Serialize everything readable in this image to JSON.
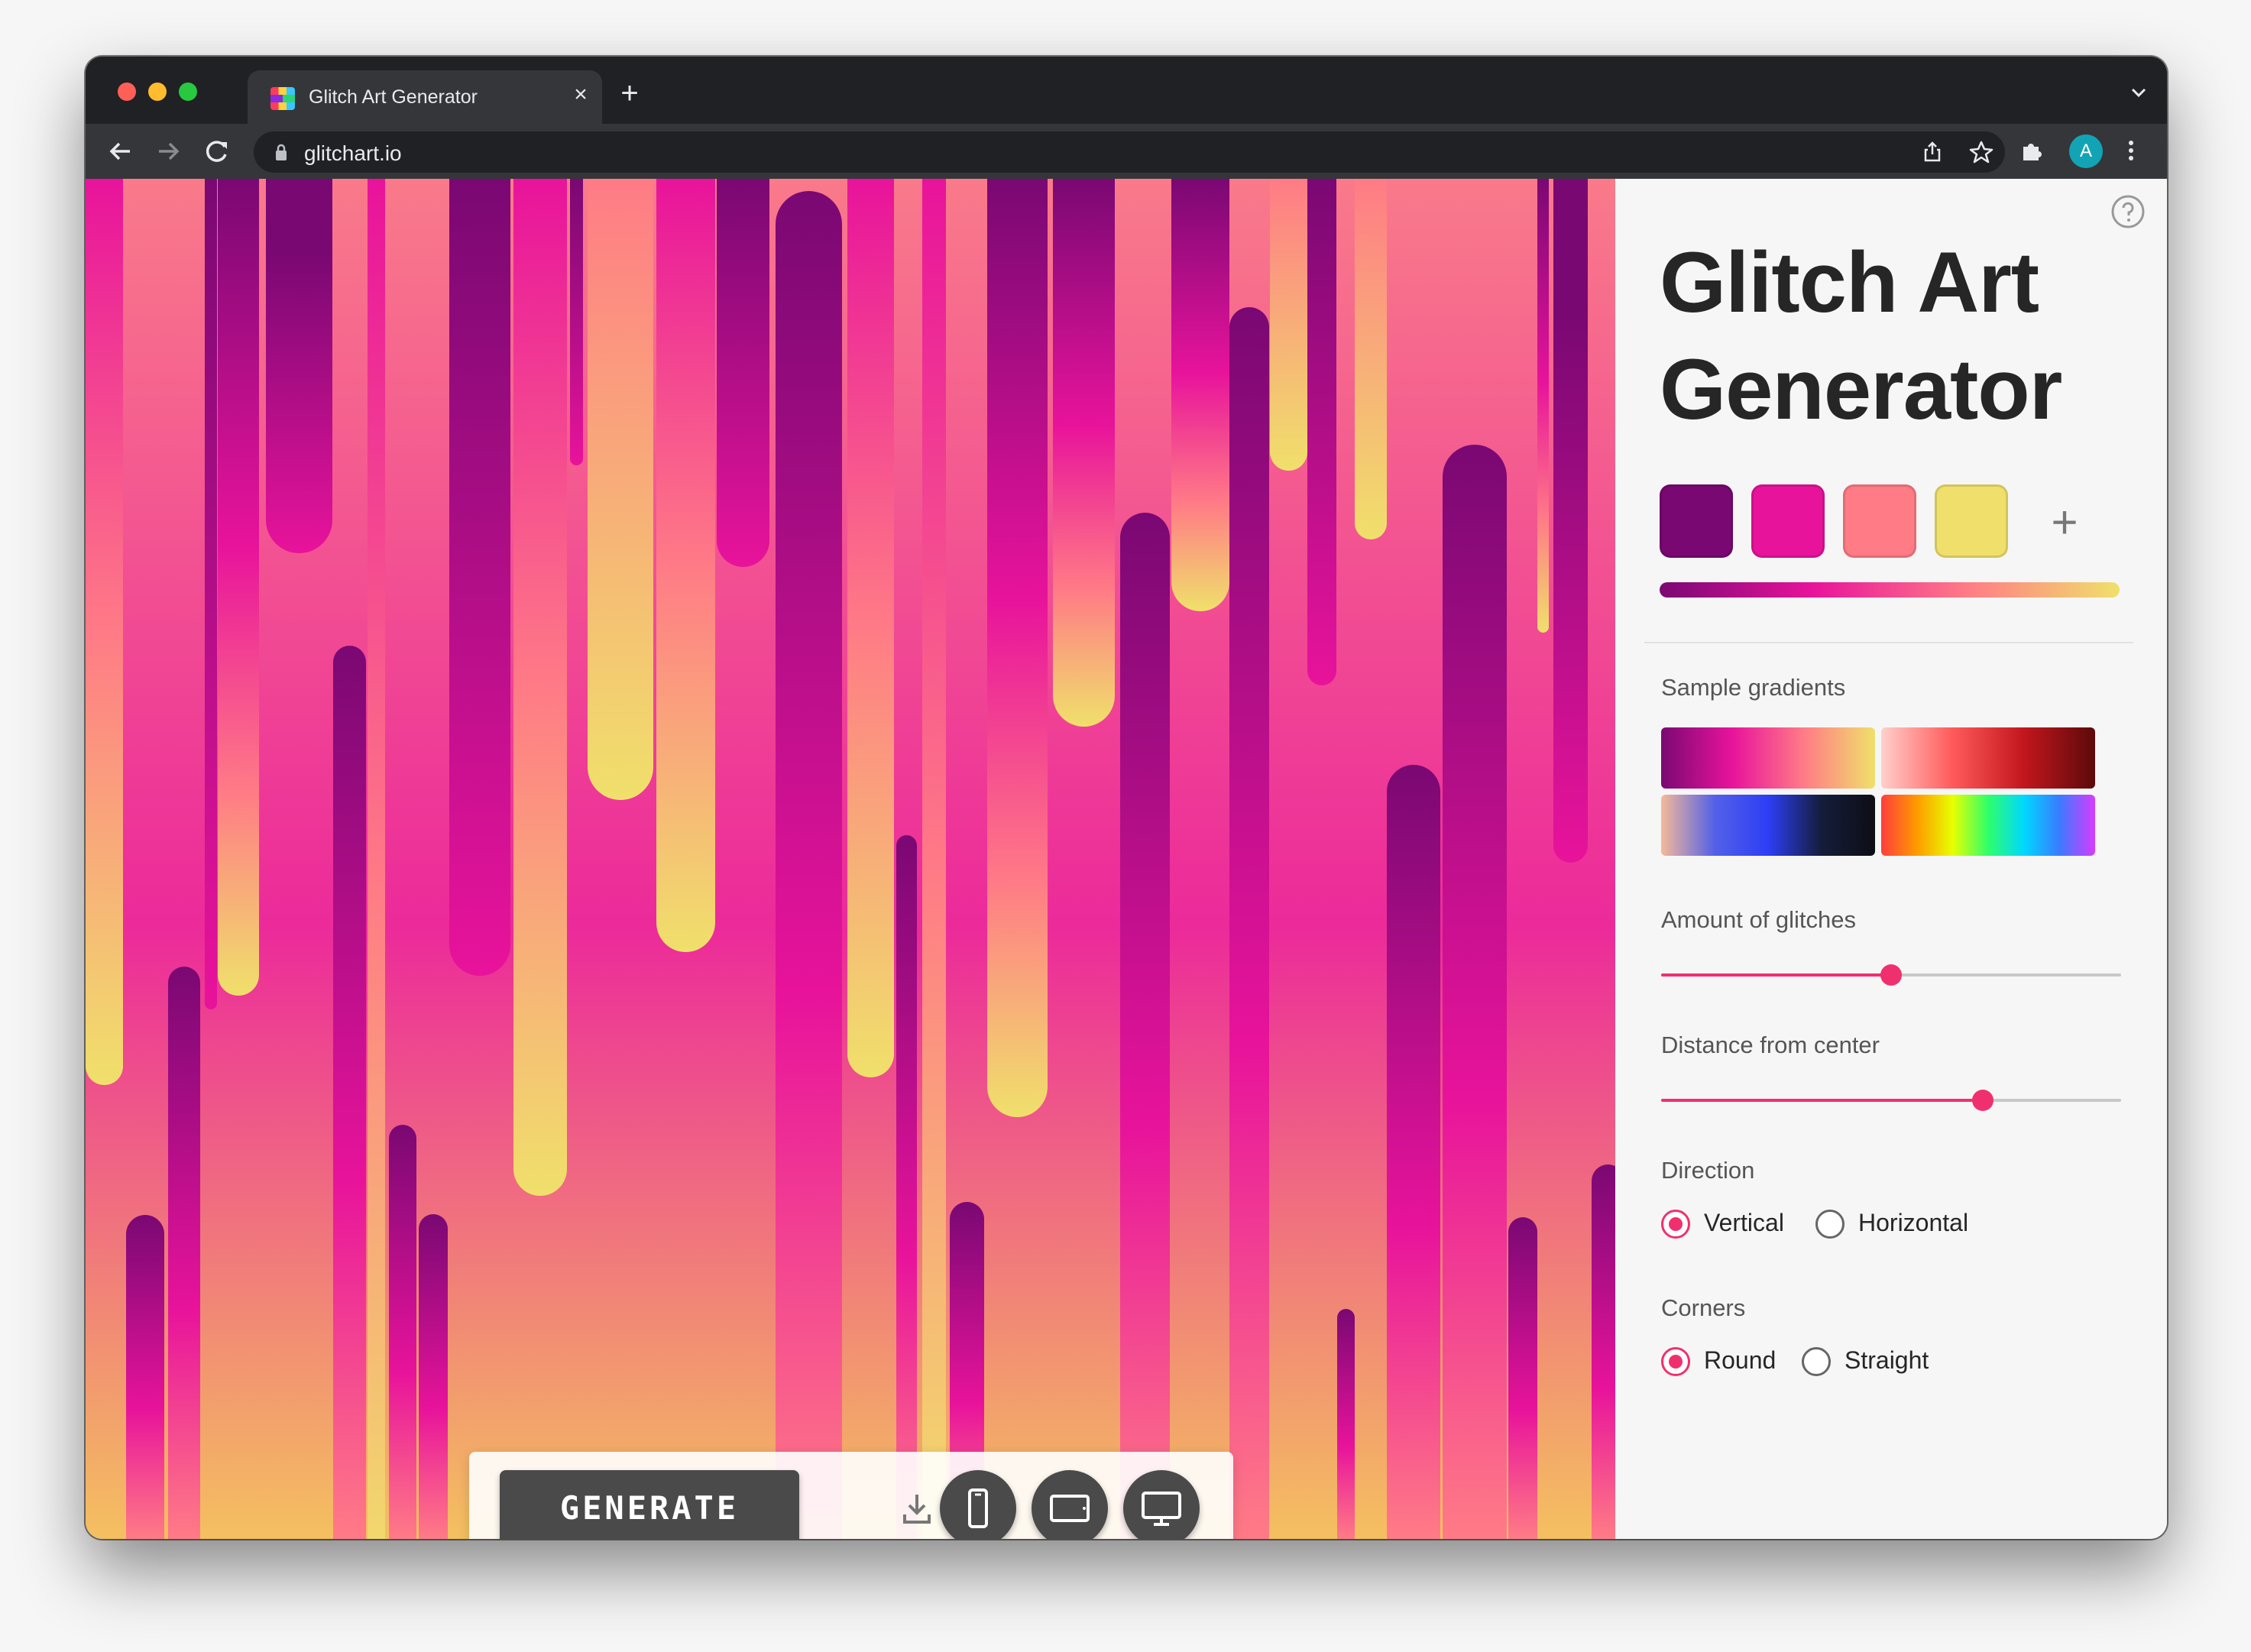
{
  "browser": {
    "tab_title": "Glitch Art Generator",
    "tab_close": "×",
    "new_tab": "+",
    "url": "glitchart.io",
    "avatar_initial": "A"
  },
  "sidebar": {
    "title_line1": "Glitch Art",
    "title_line2": "Generator",
    "swatches": [
      "#7a0873",
      "#e8139b",
      "#ff7b86",
      "#f0e06b"
    ],
    "add_color": "+",
    "gradient": [
      "#7a0873",
      "#e8139b",
      "#ff7b86",
      "#f0e06b"
    ],
    "sample_gradients_label": "Sample gradients",
    "amount_label": "Amount of glitches",
    "amount_value": 0.5,
    "distance_label": "Distance from center",
    "distance_value": 0.7,
    "direction_label": "Direction",
    "direction_options": [
      "Vertical",
      "Horizontal"
    ],
    "direction_selected": "Vertical",
    "corners_label": "Corners",
    "corners_options": [
      "Round",
      "Straight"
    ],
    "corners_selected": "Round"
  },
  "controls": {
    "generate_label": "GENERATE"
  },
  "colors": {
    "accent": "#f0306e",
    "dark_button": "#4a4a4a"
  },
  "icons": {
    "download": "download-icon",
    "phone": "phone-icon",
    "tablet": "tablet-icon",
    "desktop": "desktop-icon",
    "help": "help-icon"
  }
}
